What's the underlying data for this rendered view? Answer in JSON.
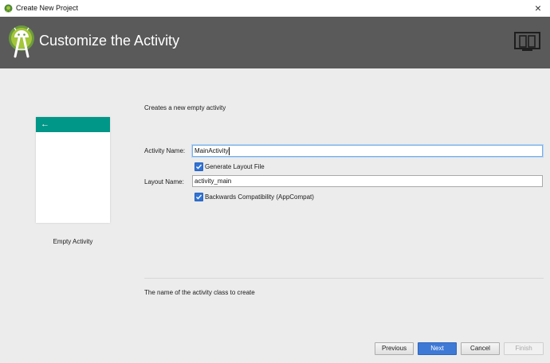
{
  "window": {
    "title": "Create New Project",
    "close_glyph": "×"
  },
  "header": {
    "title": "Customize the Activity"
  },
  "icons": {
    "app": "android-studio-icon",
    "logo": "android-studio-logo",
    "device": "device-preview-icon",
    "back": "back-arrow-icon"
  },
  "preview": {
    "back_glyph": "←",
    "template_name": "Empty Activity",
    "toolbar_color": "#009688"
  },
  "form": {
    "description": "Creates a new empty activity",
    "activity_name_label": "Activity Name:",
    "activity_name_value": "MainActivity",
    "generate_layout_label": "Generate Layout File",
    "generate_layout_checked": true,
    "layout_name_label": "Layout Name:",
    "layout_name_value": "activity_main",
    "backwards_compat_label": "Backwards Compatibility (AppCompat)",
    "backwards_compat_checked": true
  },
  "help": {
    "text": "The name of the activity class to create"
  },
  "buttons": {
    "previous": "Previous",
    "next": "Next",
    "cancel": "Cancel",
    "finish": "Finish"
  },
  "colors": {
    "accent": "#3e79d6",
    "header_bg": "#5a5a5a",
    "android_green": "#a4c639"
  }
}
